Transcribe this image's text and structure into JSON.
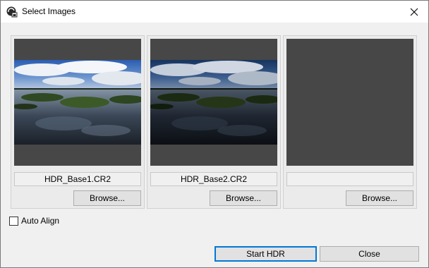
{
  "window": {
    "title": "Select Images"
  },
  "slots": [
    {
      "filename": "HDR_Base1.CR2",
      "browse_label": "Browse..."
    },
    {
      "filename": "HDR_Base2.CR2",
      "browse_label": "Browse..."
    },
    {
      "filename": "",
      "browse_label": "Browse..."
    }
  ],
  "auto_align": {
    "label": "Auto Align",
    "checked": false
  },
  "buttons": {
    "start": "Start HDR",
    "close": "Close"
  },
  "colors": {
    "accent": "#0078d7",
    "preview_bg": "#474747"
  }
}
